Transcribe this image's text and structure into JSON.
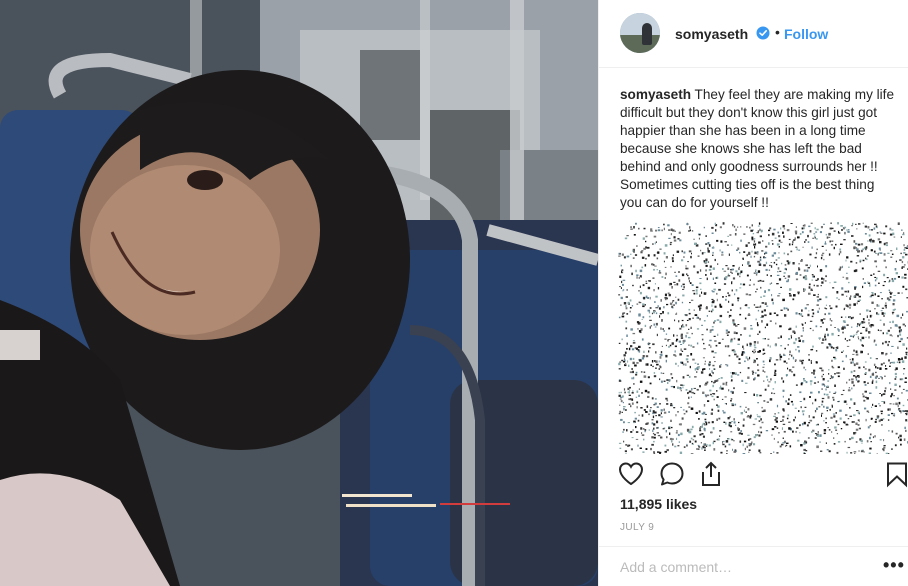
{
  "post": {
    "username": "somyaseth",
    "follow_label": "Follow",
    "separator": "•",
    "caption_user": "somyaseth",
    "caption_text": " They feel they are making my life difficult but they don't know this girl just got happier than she has been in a long time because she knows she has left the bad behind and only goodness surrounds her !! Sometimes cutting ties off is the best thing you can do for yourself !!",
    "likes": "11,895 likes",
    "date": "JULY 9",
    "comment_placeholder": "Add a comment…",
    "more_label": "•••"
  },
  "icons": {
    "verified": "verified-badge-icon",
    "like": "heart-icon",
    "comment": "comment-icon",
    "share": "share-icon",
    "save": "bookmark-icon"
  },
  "colors": {
    "accent": "#3897f0",
    "text": "#262626",
    "muted": "#999999",
    "border": "#efefef"
  }
}
